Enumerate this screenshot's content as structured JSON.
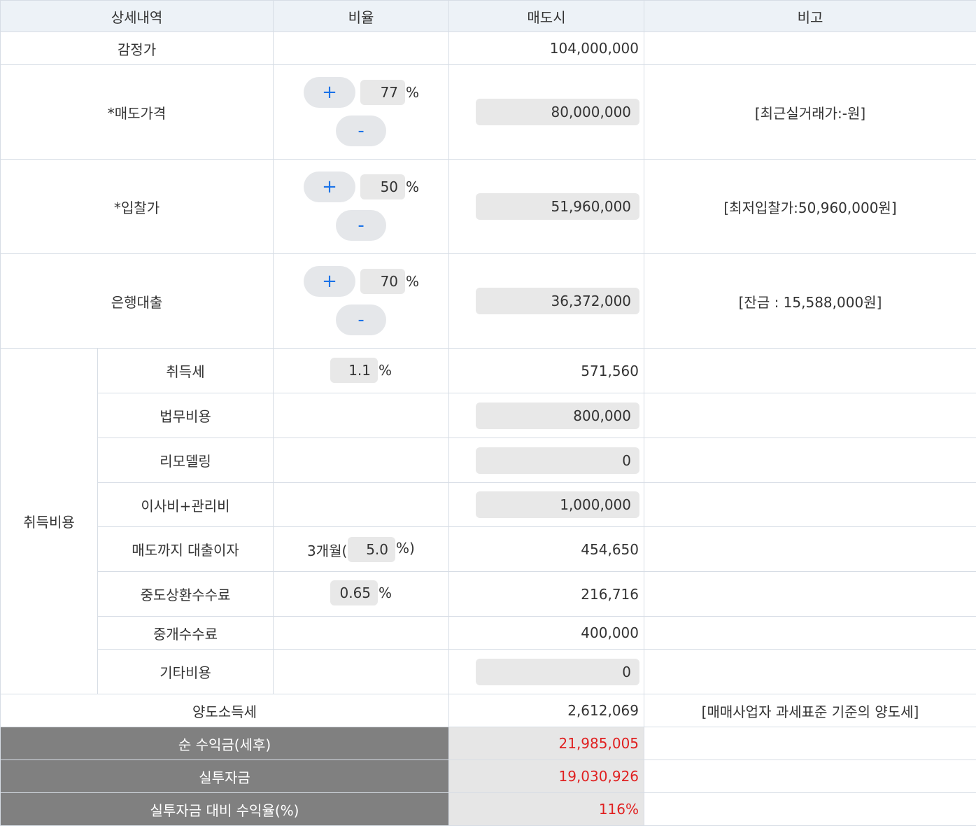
{
  "header": {
    "col1": "상세내역",
    "col2": "비율",
    "col3": "매도시",
    "col4": "비고"
  },
  "appraisal": {
    "label": "감정가",
    "value": "104,000,000"
  },
  "sale_price": {
    "label": "*매도가격",
    "plus": "+",
    "minus": "-",
    "rate": "77",
    "pct": "%",
    "value": "80,000,000",
    "note": "[최근실거래가:-원]"
  },
  "bid_price": {
    "label": "*입찰가",
    "plus": "+",
    "minus": "-",
    "rate": "50",
    "pct": "%",
    "value": "51,960,000",
    "note": "[최저입찰가:50,960,000원]"
  },
  "bank_loan": {
    "label": "은행대출",
    "plus": "+",
    "minus": "-",
    "rate": "70",
    "pct": "%",
    "value": "36,372,000",
    "note": "[잔금 : 15,588,000원]"
  },
  "acquisition": {
    "group_label": "취득비용",
    "tax": {
      "label": "취득세",
      "rate": "1.1",
      "pct": "%",
      "value": "571,560"
    },
    "legal": {
      "label": "법무비용",
      "value": "800,000"
    },
    "remodel": {
      "label": "리모델링",
      "value": "0"
    },
    "moving": {
      "label": "이사비+관리비",
      "value": "1,000,000"
    },
    "interest": {
      "label": "매도까지 대출이자",
      "prefix": "3개월(",
      "rate": "5.0",
      "suffix": "%)",
      "value": "454,650"
    },
    "prepay": {
      "label": "중도상환수수료",
      "rate": "0.65",
      "pct": "%",
      "value": "216,716"
    },
    "brokerage": {
      "label": "중개수수료",
      "value": "400,000"
    },
    "other": {
      "label": "기타비용",
      "value": "0"
    }
  },
  "capital_gains": {
    "label": "양도소득세",
    "value": "2,612,069",
    "note": "[매매사업자 과세표준 기준의 양도세]"
  },
  "net_profit": {
    "label": "순 수익금(세후)",
    "value": "21,985,005"
  },
  "actual_investment": {
    "label": "실투자금",
    "value": "19,030,926"
  },
  "roi": {
    "label": "실투자금 대비 수익율(%)",
    "value": "116%"
  }
}
